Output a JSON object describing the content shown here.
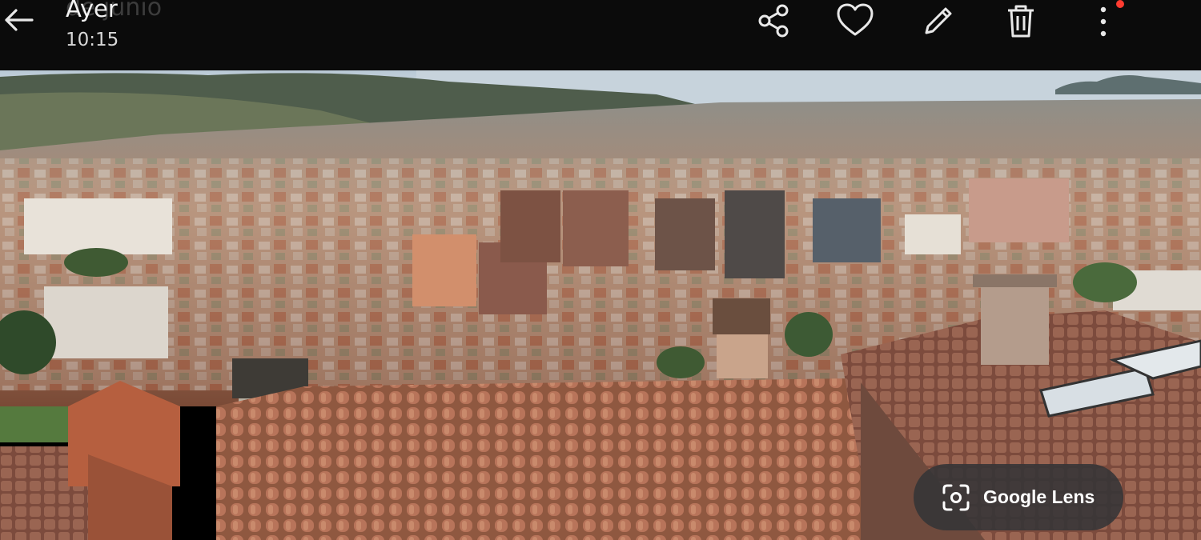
{
  "header": {
    "back_icon": "arrow-left-icon",
    "date_title": "Ayer",
    "date_title_overlap": "de junio",
    "time": "10:15",
    "actions": [
      {
        "name": "share-button",
        "icon": "share-icon"
      },
      {
        "name": "favorite-button",
        "icon": "heart-icon"
      },
      {
        "name": "edit-button",
        "icon": "pencil-icon"
      },
      {
        "name": "delete-button",
        "icon": "trash-icon"
      },
      {
        "name": "more-options-button",
        "icon": "more-vertical-icon"
      }
    ],
    "notification_dot_color": "#ff3b30"
  },
  "photo": {
    "subject": "panoramic city view over terracotta tile rooftops towards the sea"
  },
  "lens": {
    "label": "Google Lens",
    "icon": "lens-scan-icon"
  }
}
